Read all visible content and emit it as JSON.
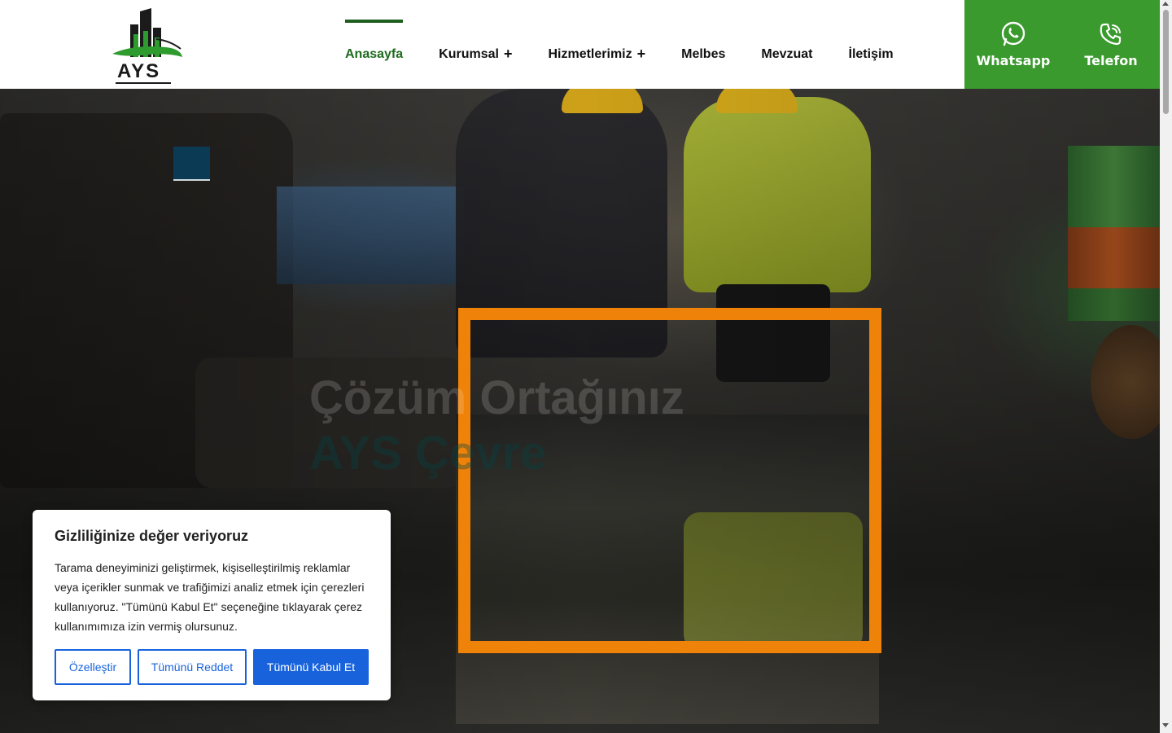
{
  "header": {
    "logo_text": "AYS",
    "nav": [
      {
        "label": "Anasayfa",
        "active": true,
        "has_submenu": false
      },
      {
        "label": "Kurumsal",
        "active": false,
        "has_submenu": true
      },
      {
        "label": "Hizmetlerimiz",
        "active": false,
        "has_submenu": true
      },
      {
        "label": "Melbes",
        "active": false,
        "has_submenu": false
      },
      {
        "label": "Mevzuat",
        "active": false,
        "has_submenu": false
      },
      {
        "label": "İletişim",
        "active": false,
        "has_submenu": false
      }
    ],
    "submenu_symbol": "+",
    "contact": {
      "whatsapp_label": "Whatsapp",
      "whatsapp_icon": "whatsapp-icon",
      "phone_label": "Telefon",
      "phone_icon": "phone-icon",
      "bg_color": "#3a9a2d"
    }
  },
  "hero": {
    "title": "Çözüm Ortağınız",
    "subtitle": "AYS Çevre",
    "frame_color": "#ef8208",
    "accent_block_color": "#0b3a54"
  },
  "cookie": {
    "title": "Gizliliğinize değer veriyoruz",
    "text": "Tarama deneyiminizi geliştirmek, kişiselleştirilmiş reklamlar veya içerikler sunmak ve trafiğimizi analiz etmek için çerezleri kullanıyoruz. \"Tümünü Kabul Et\" seçeneğine tıklayarak çerez kullanımımıza izin vermiş olursunuz.",
    "customize_label": "Özelleştir",
    "reject_label": "Tümünü Reddet",
    "accept_label": "Tümünü Kabul Et",
    "button_color": "#1863dc"
  }
}
